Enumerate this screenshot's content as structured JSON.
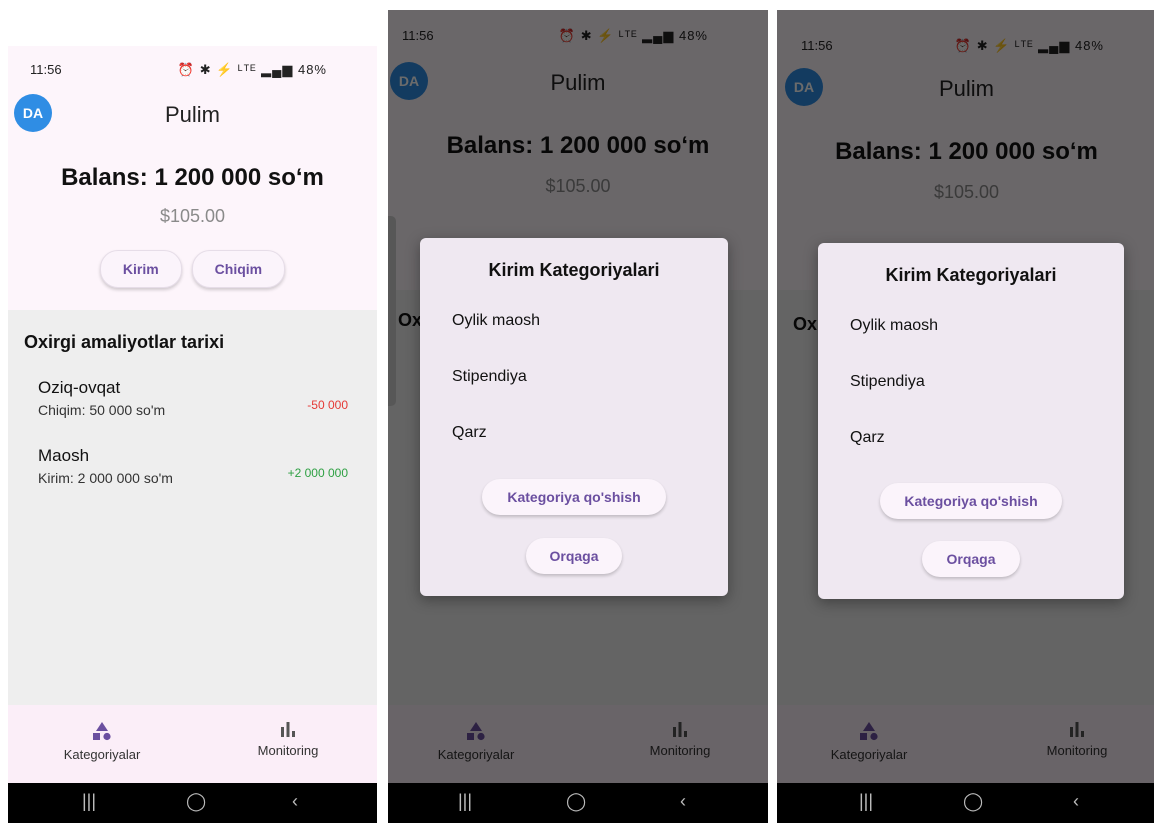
{
  "status": {
    "time": "11:56",
    "battery": "48%"
  },
  "app": {
    "title": "Pulim",
    "avatar": "DA"
  },
  "balance": {
    "label": "Balans: 1 200 000 so‘m",
    "usd": "$105.00"
  },
  "actions": {
    "income": "Kirim",
    "expense": "Chiqim"
  },
  "history": {
    "title": "Oxirgi amaliyotlar tarixi",
    "items": [
      {
        "name": "Oziq-ovqat",
        "sub": "Chiqim: 50 000 so'm",
        "amount": "-50 000"
      },
      {
        "name": "Maosh",
        "sub": "Kirim: 2 000 000 so'm",
        "amount": "+2 000 000"
      }
    ]
  },
  "nav": {
    "categories": "Kategoriyalar",
    "monitoring": "Monitoring"
  },
  "dialog": {
    "title": "Kirim Kategoriyalari",
    "options": [
      "Oylik maosh",
      "Stipendiya",
      "Qarz"
    ],
    "add": "Kategoriya qo'shish",
    "back": "Orqaga"
  },
  "colors": {
    "accent": "#6b4fa0",
    "negative": "#e53935",
    "positive": "#2ea043",
    "avatar": "#2f8de4"
  }
}
